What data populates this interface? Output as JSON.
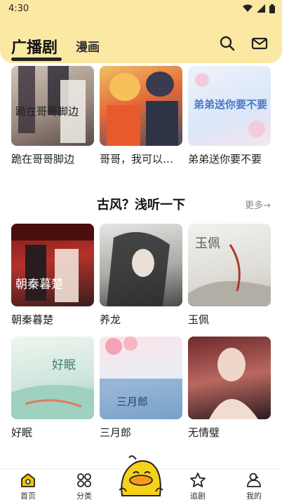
{
  "status": {
    "time": "4:30"
  },
  "header": {
    "tab_main": "广播剧",
    "tab_secondary": "漫画"
  },
  "row1": [
    {
      "title": "跪在哥哥脚边",
      "cover_text": "跪在哥哥脚边"
    },
    {
      "title": "哥哥，我可以…",
      "cover_text": ""
    },
    {
      "title": "弟弟送你要不要",
      "cover_text": "弟弟送你要不要"
    }
  ],
  "section": {
    "title": "古风？浅听一下",
    "more": "更多→"
  },
  "row2": [
    {
      "title": "朝秦暮楚",
      "cover_text": "朝秦暮楚"
    },
    {
      "title": "养龙",
      "cover_text": ""
    },
    {
      "title": "玉佩",
      "cover_text": "玉佩"
    }
  ],
  "row3": [
    {
      "title": "好眠",
      "cover_text": "好眠"
    },
    {
      "title": "三月郎",
      "cover_text": "三月郎"
    },
    {
      "title": "无情璧",
      "cover_text": ""
    }
  ],
  "nav": {
    "home": "首页",
    "category": "分类",
    "follow": "追剧",
    "mine": "我的"
  },
  "colors": {
    "header_bg": "#fbe9a3",
    "highlight": "#fce56a",
    "accent": "#f5c400"
  }
}
